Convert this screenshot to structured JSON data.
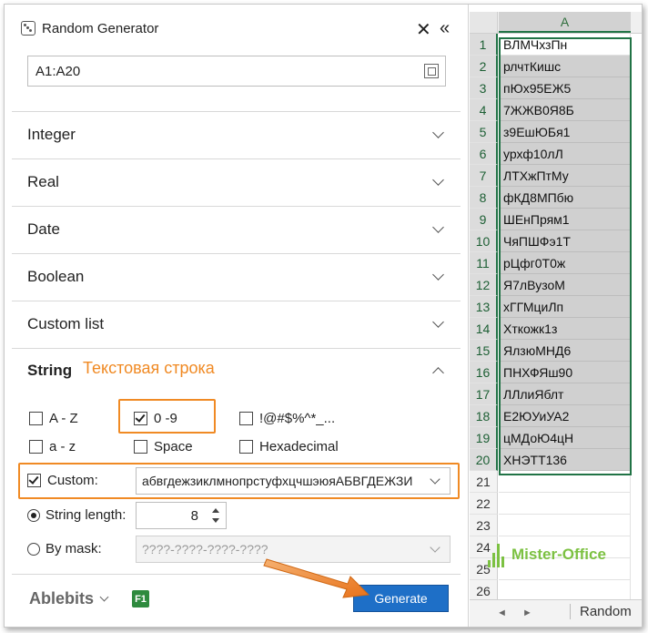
{
  "panel": {
    "title": "Random Generator",
    "close_glyph": "✕",
    "collapse_glyph": "«",
    "range": "A1:A20",
    "sections": [
      {
        "label": "Integer"
      },
      {
        "label": "Real"
      },
      {
        "label": "Date"
      },
      {
        "label": "Boolean"
      },
      {
        "label": "Custom list"
      }
    ],
    "string": {
      "label": "String",
      "annotation": "Текстовая строка",
      "options": {
        "upper": {
          "label": "A - Z",
          "checked": false
        },
        "digits": {
          "label": "0 -9",
          "checked": true
        },
        "symbols": {
          "label": "!@#$%^*_...",
          "checked": false
        },
        "lower": {
          "label": "a - z",
          "checked": false
        },
        "space": {
          "label": "Space",
          "checked": false
        },
        "hex": {
          "label": "Hexadecimal",
          "checked": false
        },
        "custom": {
          "label": "Custom:",
          "checked": true,
          "value": "абвгдежзиклмнопрстуфхцчшэюяАБВГДЕЖЗИ"
        }
      },
      "length_label": "String length:",
      "length_value": "8",
      "mask_label": "By mask:",
      "mask_placeholder": "????-????-????-????"
    },
    "footer": {
      "brand": "Ablebits",
      "help": "F1",
      "generate": "Generate"
    }
  },
  "sheet": {
    "column": "A",
    "rows": [
      {
        "n": "1",
        "v": "ВЛМЧхзПн"
      },
      {
        "n": "2",
        "v": "рлчтКишс"
      },
      {
        "n": "3",
        "v": "пЮх95ЕЖ5"
      },
      {
        "n": "4",
        "v": "7ЖЖВ0Я8Б"
      },
      {
        "n": "5",
        "v": "з9ЕшЮБя1"
      },
      {
        "n": "6",
        "v": "урхф10лЛ"
      },
      {
        "n": "7",
        "v": "ЛТХжПтМу"
      },
      {
        "n": "8",
        "v": "фКД8МПбю"
      },
      {
        "n": "9",
        "v": "ШЕнПрям1"
      },
      {
        "n": "10",
        "v": "ЧяПШФэ1Т"
      },
      {
        "n": "11",
        "v": "рЦфг0Т0ж"
      },
      {
        "n": "12",
        "v": "Я7лВузоМ"
      },
      {
        "n": "13",
        "v": "хГГМциЛп"
      },
      {
        "n": "14",
        "v": "Хткожк1з"
      },
      {
        "n": "15",
        "v": "ЯлзюМНД6"
      },
      {
        "n": "16",
        "v": "ПНХФЯш90"
      },
      {
        "n": "17",
        "v": "ЛЛлиЯблт"
      },
      {
        "n": "18",
        "v": "Е2ЮУиУА2"
      },
      {
        "n": "19",
        "v": "цМДоЮ4цН"
      },
      {
        "n": "20",
        "v": "ХНЭТТ136"
      },
      {
        "n": "21",
        "v": ""
      },
      {
        "n": "22",
        "v": ""
      },
      {
        "n": "23",
        "v": ""
      },
      {
        "n": "24",
        "v": ""
      },
      {
        "n": "25",
        "v": ""
      },
      {
        "n": "26",
        "v": ""
      }
    ],
    "sheet_tab": "Random",
    "nav_prev": "◄",
    "nav_next": "►"
  },
  "watermark": "Mister-Office",
  "colors": {
    "accent": "#f08a24",
    "excel_green": "#217346",
    "button_blue": "#1e6fc7"
  }
}
